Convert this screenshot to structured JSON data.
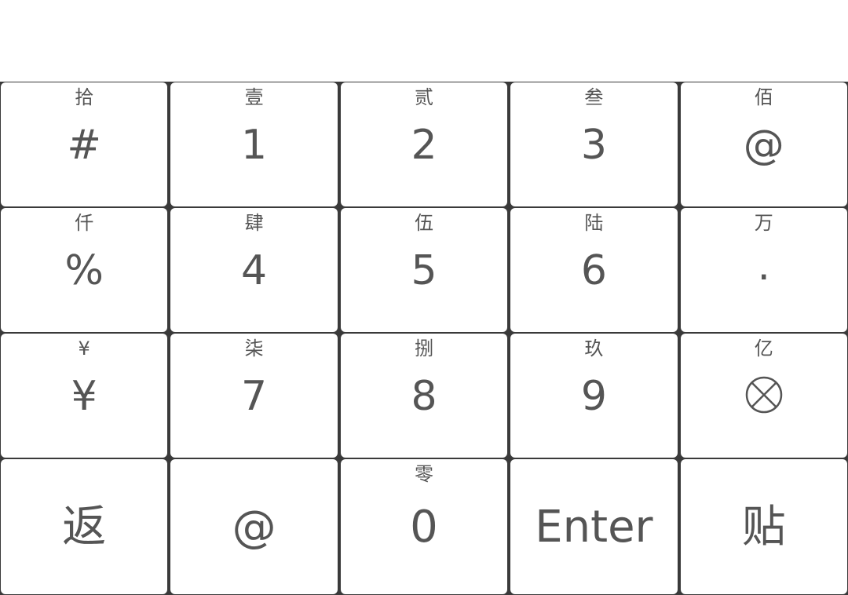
{
  "keyboard": {
    "rows": [
      [
        {
          "sub": "拾",
          "main": "#"
        },
        {
          "sub": "壹",
          "main": "1"
        },
        {
          "sub": "贰",
          "main": "2"
        },
        {
          "sub": "叁",
          "main": "3"
        },
        {
          "sub": "佰",
          "main": "@"
        }
      ],
      [
        {
          "sub": "仟",
          "main": "%"
        },
        {
          "sub": "肆",
          "main": "4"
        },
        {
          "sub": "伍",
          "main": "5"
        },
        {
          "sub": "陆",
          "main": "6"
        },
        {
          "sub": "万",
          "main": "."
        }
      ],
      [
        {
          "sub": "¥",
          "main": "¥"
        },
        {
          "sub": "柒",
          "main": "7"
        },
        {
          "sub": "捌",
          "main": "8"
        },
        {
          "sub": "玖",
          "main": "9"
        },
        {
          "sub": "亿",
          "main": "",
          "icon": "circle-x-icon"
        }
      ],
      [
        {
          "sub": "",
          "main": "返"
        },
        {
          "sub": "",
          "main": "@"
        },
        {
          "sub": "零",
          "main": "0"
        },
        {
          "sub": "",
          "main": "Enter"
        },
        {
          "sub": "",
          "main": "贴"
        }
      ]
    ]
  },
  "colors": {
    "key_text": "#555555",
    "key_bg": "#ffffff",
    "grid_line": "#3a3a3a"
  }
}
